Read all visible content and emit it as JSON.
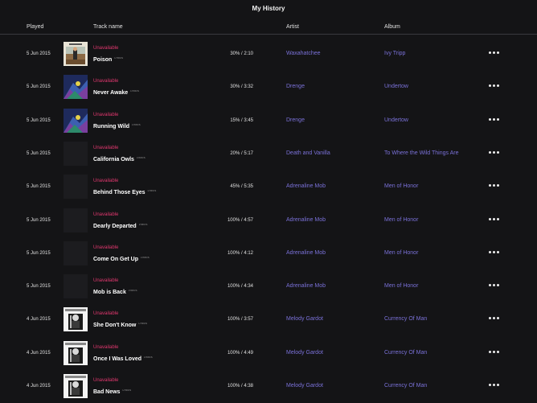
{
  "page": {
    "title": "My History"
  },
  "columns": {
    "played": "Played",
    "track": "Track name",
    "artist": "Artist",
    "album": "Album"
  },
  "explicit_label": "LYRICS",
  "rows": [
    {
      "played": "5 Jun 2015",
      "status": "Unavailable",
      "track": "Poison",
      "progress": "30% / 2:10",
      "artist": "Waxahatchee",
      "album": "Ivy Tripp",
      "art": "ivy-tripp-cover"
    },
    {
      "played": "5 Jun 2015",
      "status": "Unavailable",
      "track": "Never Awake",
      "progress": "30% / 3:32",
      "artist": "Drenge",
      "album": "Undertow",
      "art": "undertow-cover"
    },
    {
      "played": "5 Jun 2015",
      "status": "Unavailable",
      "track": "Running Wild",
      "progress": "15% / 3:45",
      "artist": "Drenge",
      "album": "Undertow",
      "art": "undertow-cover"
    },
    {
      "played": "5 Jun 2015",
      "status": "Unavailable",
      "track": "California Owls",
      "progress": "20% / 5:17",
      "artist": "Death and Vanilla",
      "album": "To Where the Wild Things Are",
      "art": "blank-cover"
    },
    {
      "played": "5 Jun 2015",
      "status": "Unavailable",
      "track": "Behind Those Eyes",
      "progress": "45% / 5:35",
      "artist": "Adrenaline Mob",
      "album": "Men of Honor",
      "art": "blank-cover"
    },
    {
      "played": "5 Jun 2015",
      "status": "Unavailable",
      "track": "Dearly Departed",
      "progress": "100% / 4:57",
      "artist": "Adrenaline Mob",
      "album": "Men of Honor",
      "art": "blank-cover"
    },
    {
      "played": "5 Jun 2015",
      "status": "Unavailable",
      "track": "Come On Get Up",
      "progress": "100% / 4:12",
      "artist": "Adrenaline Mob",
      "album": "Men of Honor",
      "art": "blank-cover"
    },
    {
      "played": "5 Jun 2015",
      "status": "Unavailable",
      "track": "Mob is Back",
      "progress": "100% / 4:34",
      "artist": "Adrenaline Mob",
      "album": "Men of Honor",
      "art": "blank-cover"
    },
    {
      "played": "4 Jun 2015",
      "status": "Unavailable",
      "track": "She Don't Know",
      "progress": "100% / 3:57",
      "artist": "Melody Gardot",
      "album": "Currency Of Man",
      "art": "currency-of-man-cover"
    },
    {
      "played": "4 Jun 2015",
      "status": "Unavailable",
      "track": "Once I Was Loved",
      "progress": "100% / 4:49",
      "artist": "Melody Gardot",
      "album": "Currency Of Man",
      "art": "currency-of-man-cover"
    },
    {
      "played": "4 Jun 2015",
      "status": "Unavailable",
      "track": "Bad News",
      "progress": "100% / 4:38",
      "artist": "Melody Gardot",
      "album": "Currency Of Man",
      "art": "currency-of-man-cover"
    }
  ]
}
